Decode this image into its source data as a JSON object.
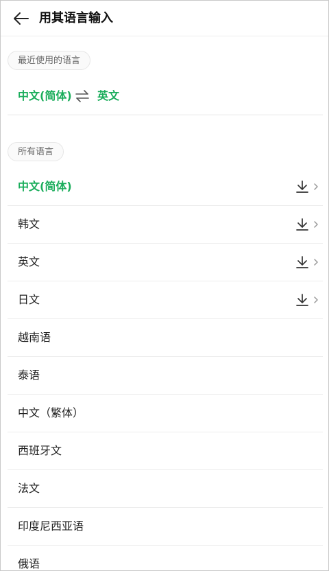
{
  "header": {
    "title": "用其语言输入",
    "back_icon": "arrow-left-icon"
  },
  "recent": {
    "section_label": "最近使用的语言",
    "source": "中文(简体)",
    "target": "英文",
    "swap_icon": "swap-arrows-icon"
  },
  "all": {
    "section_label": "所有语言",
    "items": [
      {
        "label": "中文(简体)",
        "selected": true,
        "downloadable": true
      },
      {
        "label": "韩文",
        "selected": false,
        "downloadable": true
      },
      {
        "label": "英文",
        "selected": false,
        "downloadable": true
      },
      {
        "label": "日文",
        "selected": false,
        "downloadable": true
      },
      {
        "label": "越南语",
        "selected": false,
        "downloadable": false
      },
      {
        "label": "泰语",
        "selected": false,
        "downloadable": false
      },
      {
        "label": "中文（繁体）",
        "selected": false,
        "downloadable": false
      },
      {
        "label": "西班牙文",
        "selected": false,
        "downloadable": false
      },
      {
        "label": "法文",
        "selected": false,
        "downloadable": false
      },
      {
        "label": "印度尼西亚语",
        "selected": false,
        "downloadable": false
      },
      {
        "label": "俄语",
        "selected": false,
        "downloadable": false
      }
    ]
  },
  "colors": {
    "accent": "#1aad5b",
    "text": "#222222",
    "muted": "#666666"
  }
}
